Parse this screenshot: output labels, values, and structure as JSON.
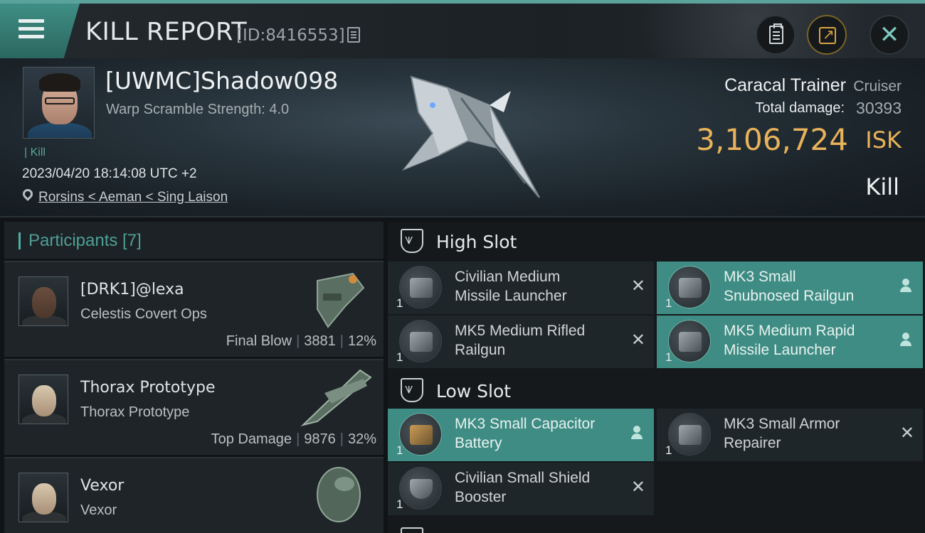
{
  "topbar": {
    "title": "KILL REPORT",
    "report_id": "[ID:8416553]",
    "icons": [
      "menu-icon",
      "copy-icon",
      "clipboard-icon",
      "share-icon",
      "close-icon"
    ],
    "close_glyph": "✕"
  },
  "victim": {
    "name": "[UWMC]Shadow098",
    "warp_scramble": "Warp Scramble Strength: 4.0",
    "tag": "| Kill",
    "datetime": "2023/04/20 18:14:08 UTC +2",
    "location": "Rorsins < Aeman < Sing Laison",
    "ship_name": "Caracal Trainer",
    "ship_class": "Cruiser",
    "total_damage_label": "Total damage:",
    "total_damage": "30393",
    "isk_value": "3,106,724",
    "isk_unit": "ISK",
    "result": "Kill"
  },
  "participants": {
    "header": "Participants [7]",
    "list": [
      {
        "name": "[DRK1]@lexa",
        "ship": "Celestis Covert Ops",
        "role": "Final Blow",
        "damage": "3881",
        "percent": "12%"
      },
      {
        "name": "Thorax Prototype",
        "ship": "Thorax Prototype",
        "role": "Top Damage",
        "damage": "9876",
        "percent": "32%"
      },
      {
        "name": "Vexor",
        "ship": "Vexor",
        "role": "",
        "damage": "",
        "percent": ""
      }
    ]
  },
  "fitting": {
    "high_slot_label": "High Slot",
    "low_slot_label": "Low Slot",
    "high_slot": [
      {
        "line1": "Civilian Medium",
        "line2": "Missile Launcher",
        "qty": "1",
        "status": "destroyed",
        "status_glyph": "✕"
      },
      {
        "line1": "MK3 Small",
        "line2": "Snubnosed Railgun",
        "qty": "1",
        "status": "dropped"
      },
      {
        "line1": "MK5 Medium Rifled",
        "line2": "Railgun",
        "qty": "1",
        "status": "destroyed",
        "status_glyph": "✕"
      },
      {
        "line1": "MK5 Medium Rapid",
        "line2": "Missile Launcher",
        "qty": "1",
        "status": "dropped"
      }
    ],
    "low_slot": [
      {
        "line1": "MK3 Small Capacitor",
        "line2": "Battery",
        "qty": "1",
        "status": "dropped"
      },
      {
        "line1": "MK3 Small Armor",
        "line2": "Repairer",
        "qty": "1",
        "status": "destroyed",
        "status_glyph": "✕"
      },
      {
        "line1": "Civilian Small Shield",
        "line2": "Booster",
        "qty": "1",
        "status": "destroyed",
        "status_glyph": "✕"
      }
    ]
  },
  "colors": {
    "accent_teal": "#3e8c83",
    "isk_gold": "#e7b25a",
    "background": "#111417"
  }
}
